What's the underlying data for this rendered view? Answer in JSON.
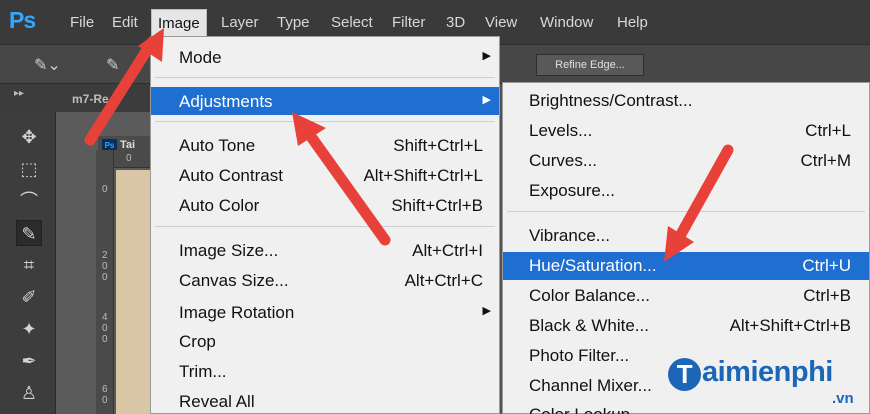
{
  "app": {
    "logo": "Ps"
  },
  "menubar": {
    "items": [
      "File",
      "Edit",
      "Image",
      "Layer",
      "Type",
      "Select",
      "Filter",
      "3D",
      "View",
      "Window",
      "Help"
    ],
    "active": "Image"
  },
  "optionsbar": {
    "refine_edge": "Refine Edge..."
  },
  "workspace": {
    "tab_label": "m7-Re",
    "doc_tab": "Tai",
    "doc_icon": "Ps",
    "ruler_h": [
      "0"
    ],
    "ruler_v": [
      "0",
      "2\n0\n0",
      "4\n0\n0",
      "6\n0"
    ]
  },
  "image_menu": {
    "items": [
      {
        "label": "Mode",
        "shortcut": "",
        "submenu": true
      },
      {
        "label": "Adjustments",
        "shortcut": "",
        "submenu": true,
        "highlighted": true
      },
      {
        "label": "Auto Tone",
        "shortcut": "Shift+Ctrl+L"
      },
      {
        "label": "Auto Contrast",
        "shortcut": "Alt+Shift+Ctrl+L"
      },
      {
        "label": "Auto Color",
        "shortcut": "Shift+Ctrl+B"
      },
      {
        "label": "Image Size...",
        "shortcut": "Alt+Ctrl+I"
      },
      {
        "label": "Canvas Size...",
        "shortcut": "Alt+Ctrl+C"
      },
      {
        "label": "Image Rotation",
        "shortcut": "",
        "submenu": true
      },
      {
        "label": "Crop",
        "shortcut": ""
      },
      {
        "label": "Trim...",
        "shortcut": ""
      },
      {
        "label": "Reveal All",
        "shortcut": ""
      }
    ]
  },
  "adjustments_menu": {
    "items": [
      {
        "label": "Brightness/Contrast...",
        "shortcut": ""
      },
      {
        "label": "Levels...",
        "shortcut": "Ctrl+L"
      },
      {
        "label": "Curves...",
        "shortcut": "Ctrl+M"
      },
      {
        "label": "Exposure...",
        "shortcut": ""
      },
      {
        "label": "Vibrance...",
        "shortcut": ""
      },
      {
        "label": "Hue/Saturation...",
        "shortcut": "Ctrl+U",
        "highlighted": true
      },
      {
        "label": "Color Balance...",
        "shortcut": "Ctrl+B"
      },
      {
        "label": "Black & White...",
        "shortcut": "Alt+Shift+Ctrl+B"
      },
      {
        "label": "Photo Filter...",
        "shortcut": ""
      },
      {
        "label": "Channel Mixer...",
        "shortcut": ""
      },
      {
        "label": "Color Lookup...",
        "shortcut": ""
      }
    ]
  },
  "watermark": {
    "initial": "T",
    "text": "aimienphi",
    "suffix": ".vn"
  },
  "colors": {
    "highlight": "#1e6fd1",
    "arrow": "#e8413a",
    "ps_blue": "#31a8ff",
    "watermark": "#1c66b8"
  }
}
